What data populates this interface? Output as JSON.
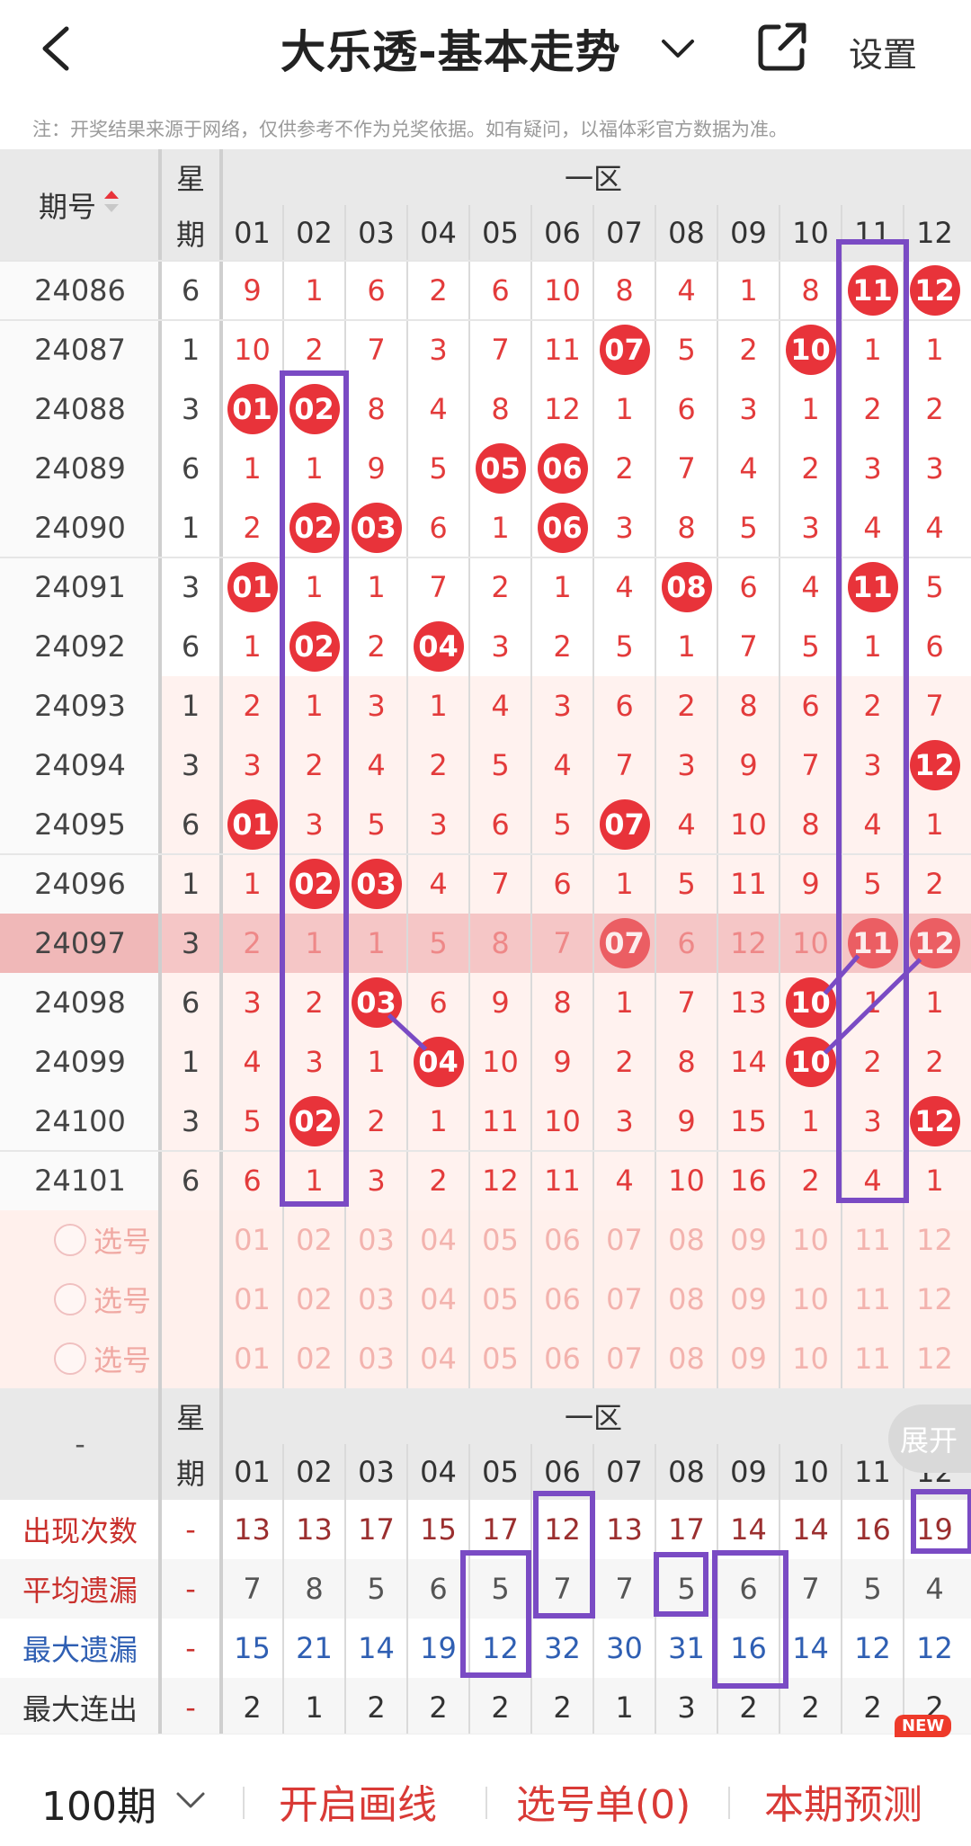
{
  "header": {
    "title": "大乐透-基本走势",
    "settings_label": "设置"
  },
  "notice": "注：开奖结果来源于网络，仅供参考不作为兑奖依据。如有疑问，以福体彩官方数据为准。",
  "table": {
    "issue_header": "期号",
    "weekday_header_1": "星",
    "weekday_header_2": "期",
    "zone_label": "一区",
    "columns": [
      "01",
      "02",
      "03",
      "04",
      "05",
      "06",
      "07",
      "08",
      "09",
      "10",
      "11",
      "12"
    ],
    "rows": [
      {
        "issue": "24086",
        "weekday": "6",
        "cells": [
          "9",
          "1",
          "6",
          "2",
          "6",
          "10",
          "8",
          "4",
          "1",
          "8",
          "11",
          "12"
        ],
        "hits": [
          10,
          11
        ]
      },
      {
        "issue": "24087",
        "weekday": "1",
        "cells": [
          "10",
          "2",
          "7",
          "3",
          "7",
          "11",
          "07",
          "5",
          "2",
          "10",
          "1",
          "1"
        ],
        "hits": [
          6,
          9
        ]
      },
      {
        "issue": "24088",
        "weekday": "3",
        "cells": [
          "01",
          "02",
          "8",
          "4",
          "8",
          "12",
          "1",
          "6",
          "3",
          "1",
          "2",
          "2"
        ],
        "hits": [
          0,
          1
        ]
      },
      {
        "issue": "24089",
        "weekday": "6",
        "cells": [
          "1",
          "1",
          "9",
          "5",
          "05",
          "06",
          "2",
          "7",
          "4",
          "2",
          "3",
          "3"
        ],
        "hits": [
          4,
          5
        ]
      },
      {
        "issue": "24090",
        "weekday": "1",
        "cells": [
          "2",
          "02",
          "03",
          "6",
          "1",
          "06",
          "3",
          "8",
          "5",
          "3",
          "4",
          "4"
        ],
        "hits": [
          1,
          2,
          5
        ]
      },
      {
        "issue": "24091",
        "weekday": "3",
        "cells": [
          "01",
          "1",
          "1",
          "7",
          "2",
          "1",
          "4",
          "08",
          "6",
          "4",
          "11",
          "5"
        ],
        "hits": [
          0,
          7,
          10
        ]
      },
      {
        "issue": "24092",
        "weekday": "6",
        "cells": [
          "1",
          "02",
          "2",
          "04",
          "3",
          "2",
          "5",
          "1",
          "7",
          "5",
          "1",
          "6"
        ],
        "hits": [
          1,
          3
        ]
      },
      {
        "issue": "24093",
        "weekday": "1",
        "cells": [
          "2",
          "1",
          "3",
          "1",
          "4",
          "3",
          "6",
          "2",
          "8",
          "6",
          "2",
          "7"
        ],
        "hits": []
      },
      {
        "issue": "24094",
        "weekday": "3",
        "cells": [
          "3",
          "2",
          "4",
          "2",
          "5",
          "4",
          "7",
          "3",
          "9",
          "7",
          "3",
          "12"
        ],
        "hits": [
          11
        ]
      },
      {
        "issue": "24095",
        "weekday": "6",
        "cells": [
          "01",
          "3",
          "5",
          "3",
          "6",
          "5",
          "07",
          "4",
          "10",
          "8",
          "4",
          "1"
        ],
        "hits": [
          0,
          6
        ]
      },
      {
        "issue": "24096",
        "weekday": "1",
        "cells": [
          "1",
          "02",
          "03",
          "4",
          "7",
          "6",
          "1",
          "5",
          "11",
          "9",
          "5",
          "2"
        ],
        "hits": [
          1,
          2
        ]
      },
      {
        "issue": "24097",
        "weekday": "3",
        "cells": [
          "2",
          "1",
          "1",
          "5",
          "8",
          "7",
          "07",
          "6",
          "12",
          "10",
          "11",
          "12"
        ],
        "hits": [
          6,
          10,
          11
        ]
      },
      {
        "issue": "24098",
        "weekday": "6",
        "cells": [
          "3",
          "2",
          "03",
          "6",
          "9",
          "8",
          "1",
          "7",
          "13",
          "10",
          "1",
          "1"
        ],
        "hits": [
          2,
          9
        ]
      },
      {
        "issue": "24099",
        "weekday": "1",
        "cells": [
          "4",
          "3",
          "1",
          "04",
          "10",
          "9",
          "2",
          "8",
          "14",
          "10",
          "2",
          "2"
        ],
        "hits": [
          3,
          9
        ]
      },
      {
        "issue": "24100",
        "weekday": "3",
        "cells": [
          "5",
          "02",
          "2",
          "1",
          "11",
          "10",
          "3",
          "9",
          "15",
          "1",
          "3",
          "12"
        ],
        "hits": [
          1,
          11
        ]
      },
      {
        "issue": "24101",
        "weekday": "6",
        "cells": [
          "6",
          "1",
          "3",
          "2",
          "12",
          "11",
          "4",
          "10",
          "16",
          "2",
          "4",
          "1"
        ],
        "hits": []
      }
    ],
    "select_rows": [
      {
        "label": "选号"
      },
      {
        "label": "选号"
      },
      {
        "label": "选号"
      }
    ],
    "select_numbers": [
      "01",
      "02",
      "03",
      "04",
      "05",
      "06",
      "07",
      "08",
      "09",
      "10",
      "11",
      "12"
    ]
  },
  "stats": {
    "header_left": "-",
    "weekday_header_1": "星",
    "weekday_header_2": "期",
    "zone_label": "一区",
    "expand_label": "展开",
    "rows": [
      {
        "label": "出现次数",
        "dash": "-",
        "values": [
          "13",
          "13",
          "17",
          "15",
          "17",
          "12",
          "13",
          "17",
          "14",
          "14",
          "16",
          "19"
        ],
        "label_color": "#c9302c",
        "value_color": "#9b2f2f"
      },
      {
        "label": "平均遗漏",
        "dash": "-",
        "values": [
          "7",
          "8",
          "5",
          "6",
          "5",
          "7",
          "7",
          "5",
          "6",
          "7",
          "5",
          "4"
        ],
        "label_color": "#c9302c",
        "value_color": "#555555"
      },
      {
        "label": "最大遗漏",
        "dash": "-",
        "values": [
          "15",
          "21",
          "14",
          "19",
          "12",
          "32",
          "30",
          "31",
          "16",
          "14",
          "12",
          "12"
        ],
        "label_color": "#2f5fb3",
        "value_color": "#2f5fb3"
      },
      {
        "label": "最大连出",
        "dash": "-",
        "values": [
          "2",
          "1",
          "2",
          "2",
          "2",
          "2",
          "1",
          "3",
          "2",
          "2",
          "2",
          "2"
        ],
        "label_color": "#333333",
        "value_color": "#333333"
      }
    ]
  },
  "bottom_bar": {
    "periods_label": "100期",
    "draw_lines_label": "开启画线",
    "selection_label": "选号单(0)",
    "prediction_label": "本期预测",
    "new_badge": "NEW"
  },
  "colors": {
    "accent": "#e8333a",
    "annotation": "#7a4bc4",
    "highlight_row": "#f5c6c6"
  }
}
